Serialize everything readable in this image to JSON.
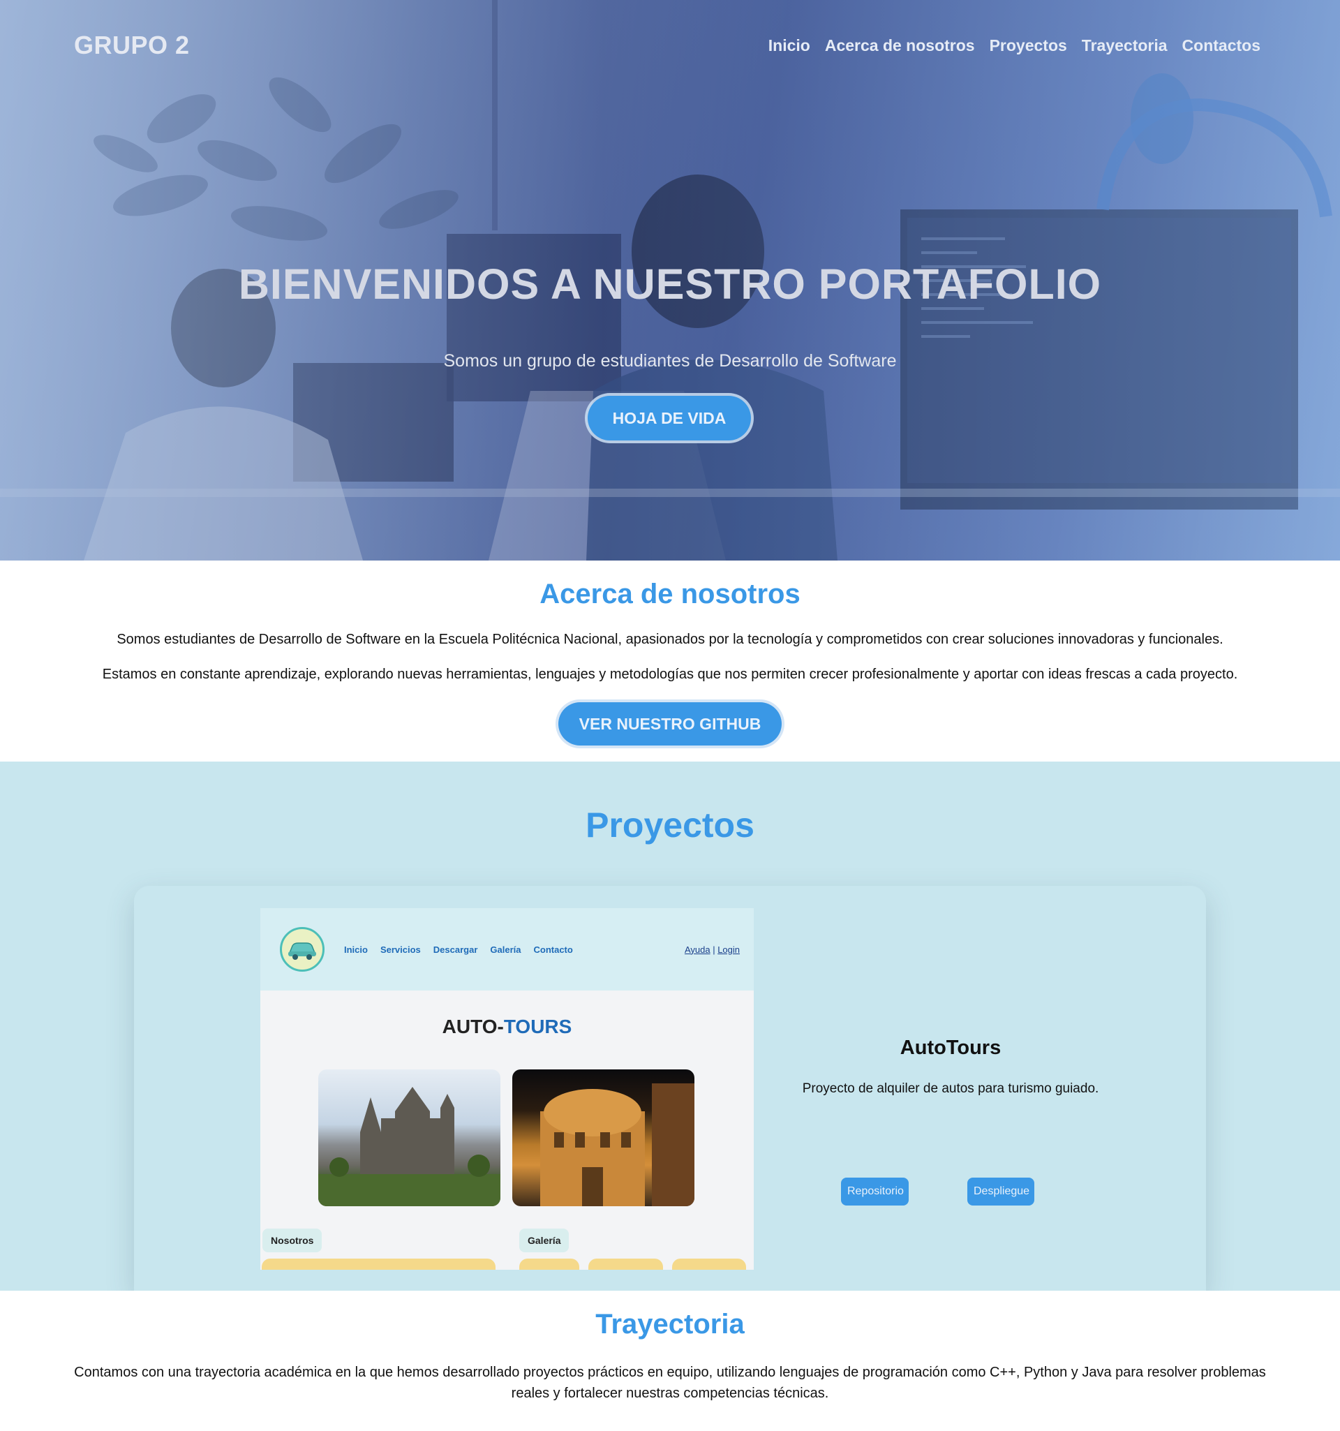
{
  "nav": {
    "brand": "GRUPO 2",
    "links": [
      "Inicio",
      "Acerca de nosotros",
      "Proyectos",
      "Trayectoria",
      "Contactos"
    ]
  },
  "hero": {
    "title": "BIENVENIDOS A NUESTRO PORTAFOLIO",
    "subtitle": "Somos un grupo de estudiantes de Desarrollo de Software",
    "button": "HOJA DE VIDA"
  },
  "about": {
    "title": "Acerca de nosotros",
    "paragraph1": "Somos estudiantes de Desarrollo de Software en la Escuela Politécnica Nacional, apasionados por la tecnología y comprometidos con crear soluciones innovadoras y funcionales.",
    "paragraph2": "Estamos en constante aprendizaje, explorando nuevas herramientas, lenguajes y metodologías que nos permiten crecer profesionalmente y aportar con ideas frescas a cada proyecto.",
    "button": "VER NUESTRO GITHUB"
  },
  "projects": {
    "title": "Proyectos",
    "items": [
      {
        "screenshot": {
          "menu": [
            "Inicio",
            "Servicios",
            "Descargar",
            "Galería",
            "Contacto"
          ],
          "auth_help": "Ayuda",
          "auth_sep": " | ",
          "auth_login": "Login",
          "title_main": "AUTO-",
          "title_accent": "TOURS",
          "chip_about": "Nosotros",
          "chip_gallery": "Galería"
        },
        "name": "AutoTours",
        "description": "Proyecto de alquiler de autos para turismo guiado.",
        "repo_button": "Repositorio",
        "deploy_button": "Despliegue"
      }
    ]
  },
  "trajectory": {
    "title": "Trayectoria",
    "paragraph": "Contamos con una trayectoria académica en la que hemos desarrollado proyectos prácticos en equipo, utilizando lenguajes de programación como C++, Python y Java para resolver problemas reales y fortalecer nuestras competencias técnicas."
  },
  "colors": {
    "accent": "#3a98e6",
    "projects_bg": "#c8e6ee",
    "hero_tint": "#6f86b7"
  }
}
